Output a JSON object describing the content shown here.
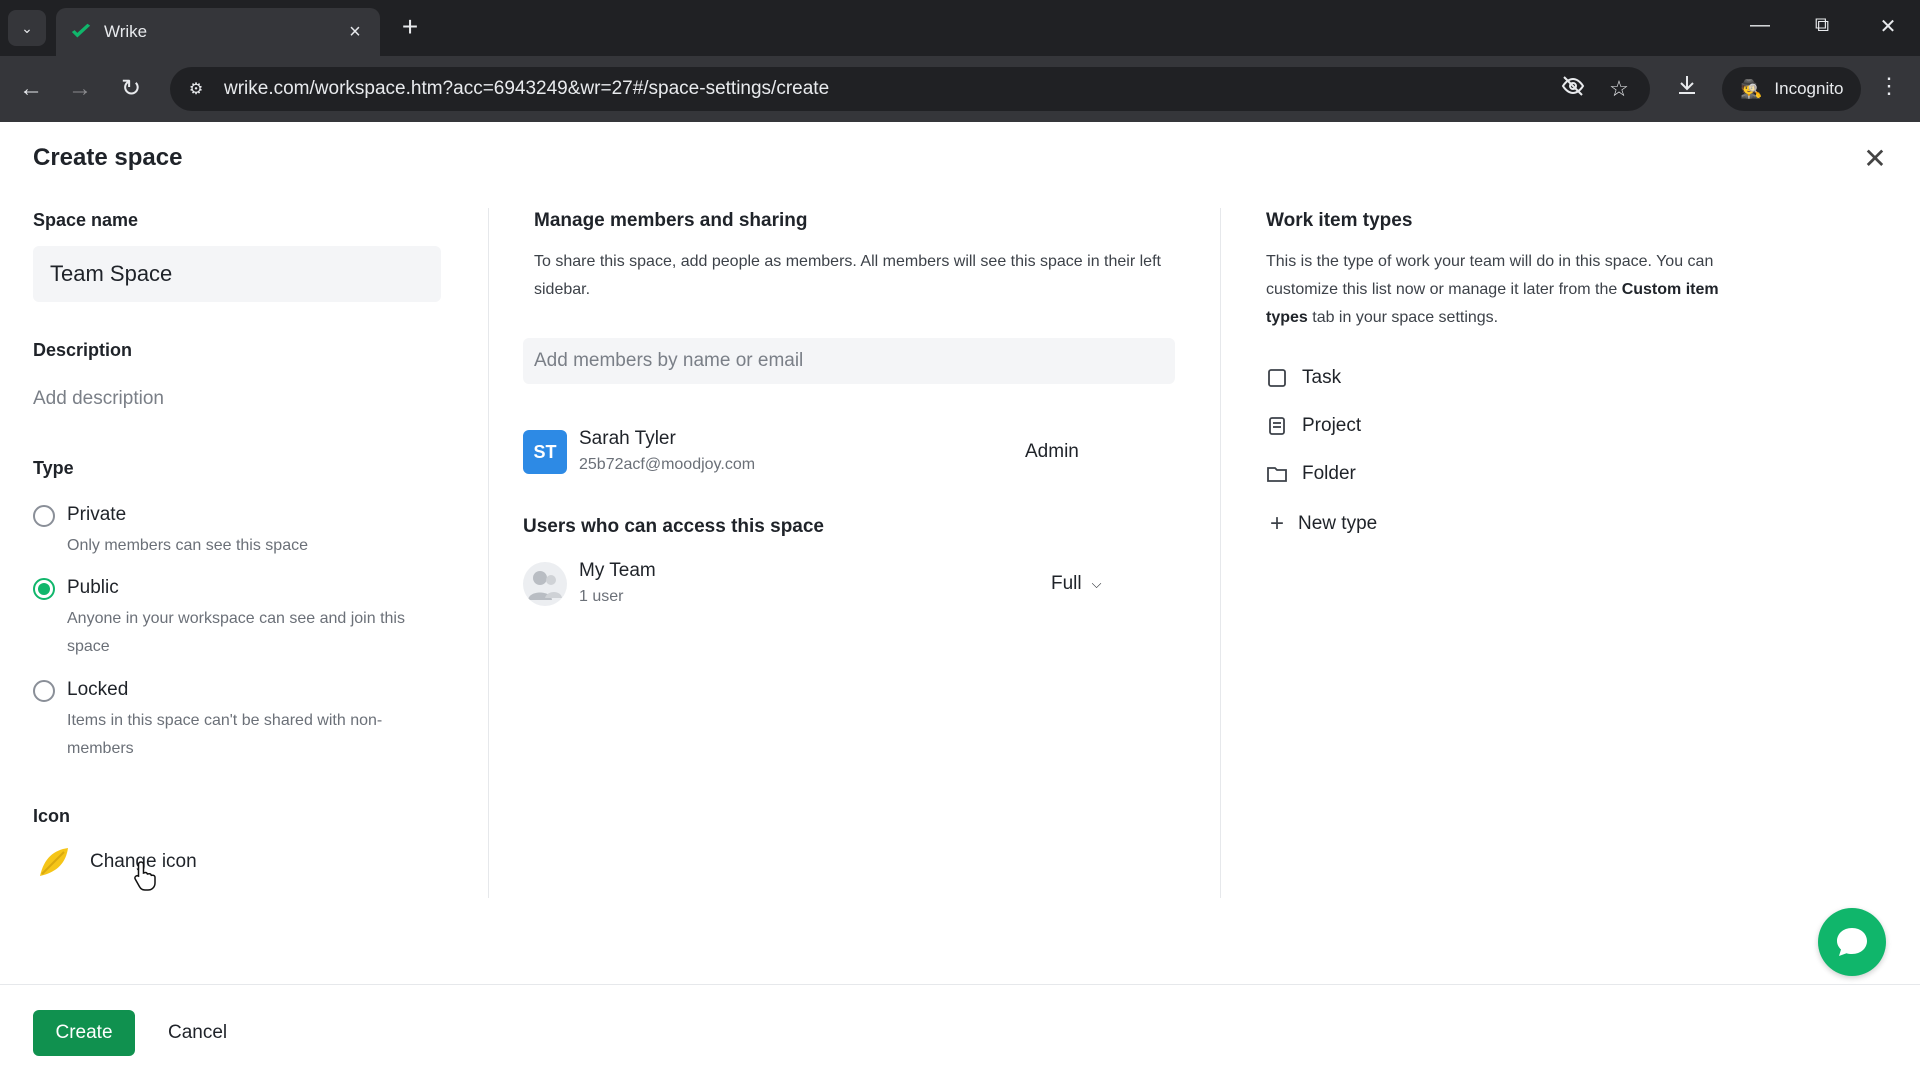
{
  "browser": {
    "tab_title": "Wrike",
    "url": "wrike.com/workspace.htm?acc=6943249&wr=27#/space-settings/create",
    "incognito_label": "Incognito"
  },
  "dialog": {
    "title": "Create space",
    "space_name_label": "Space name",
    "space_name_value": "Team Space",
    "description_label": "Description",
    "description_placeholder": "Add description",
    "type_label": "Type",
    "types": [
      {
        "title": "Private",
        "sub": "Only members can see this space",
        "checked": false
      },
      {
        "title": "Public",
        "sub": "Anyone in your workspace can see and join this space",
        "checked": true
      },
      {
        "title": "Locked",
        "sub": "Items in this space can't be shared with non-members",
        "checked": false
      }
    ],
    "icon_label": "Icon",
    "change_icon": "Change icon"
  },
  "members": {
    "title": "Manage members and sharing",
    "text": "To share this space, add people as members. All members will see this space in their left sidebar.",
    "add_placeholder": "Add members by name or email",
    "list": [
      {
        "initials": "ST",
        "name": "Sarah Tyler",
        "email": "25b72acf@moodjoy.com",
        "role": "Admin"
      }
    ],
    "access_title": "Users who can access this space",
    "team": {
      "name": "My Team",
      "count": "1 user",
      "access": "Full"
    }
  },
  "work_items": {
    "title": "Work item types",
    "text_before": "This is the type of work your team will do in this space. You can customize this list now or manage it later from the ",
    "text_bold": "Custom item types",
    "text_after": " tab in your space settings.",
    "items": [
      "Task",
      "Project",
      "Folder"
    ],
    "new_type": "New type"
  },
  "footer": {
    "create": "Create",
    "cancel": "Cancel"
  },
  "colors": {
    "accent": "#10b66b",
    "create_button": "#10914f",
    "avatar": "#2d8ae5"
  }
}
